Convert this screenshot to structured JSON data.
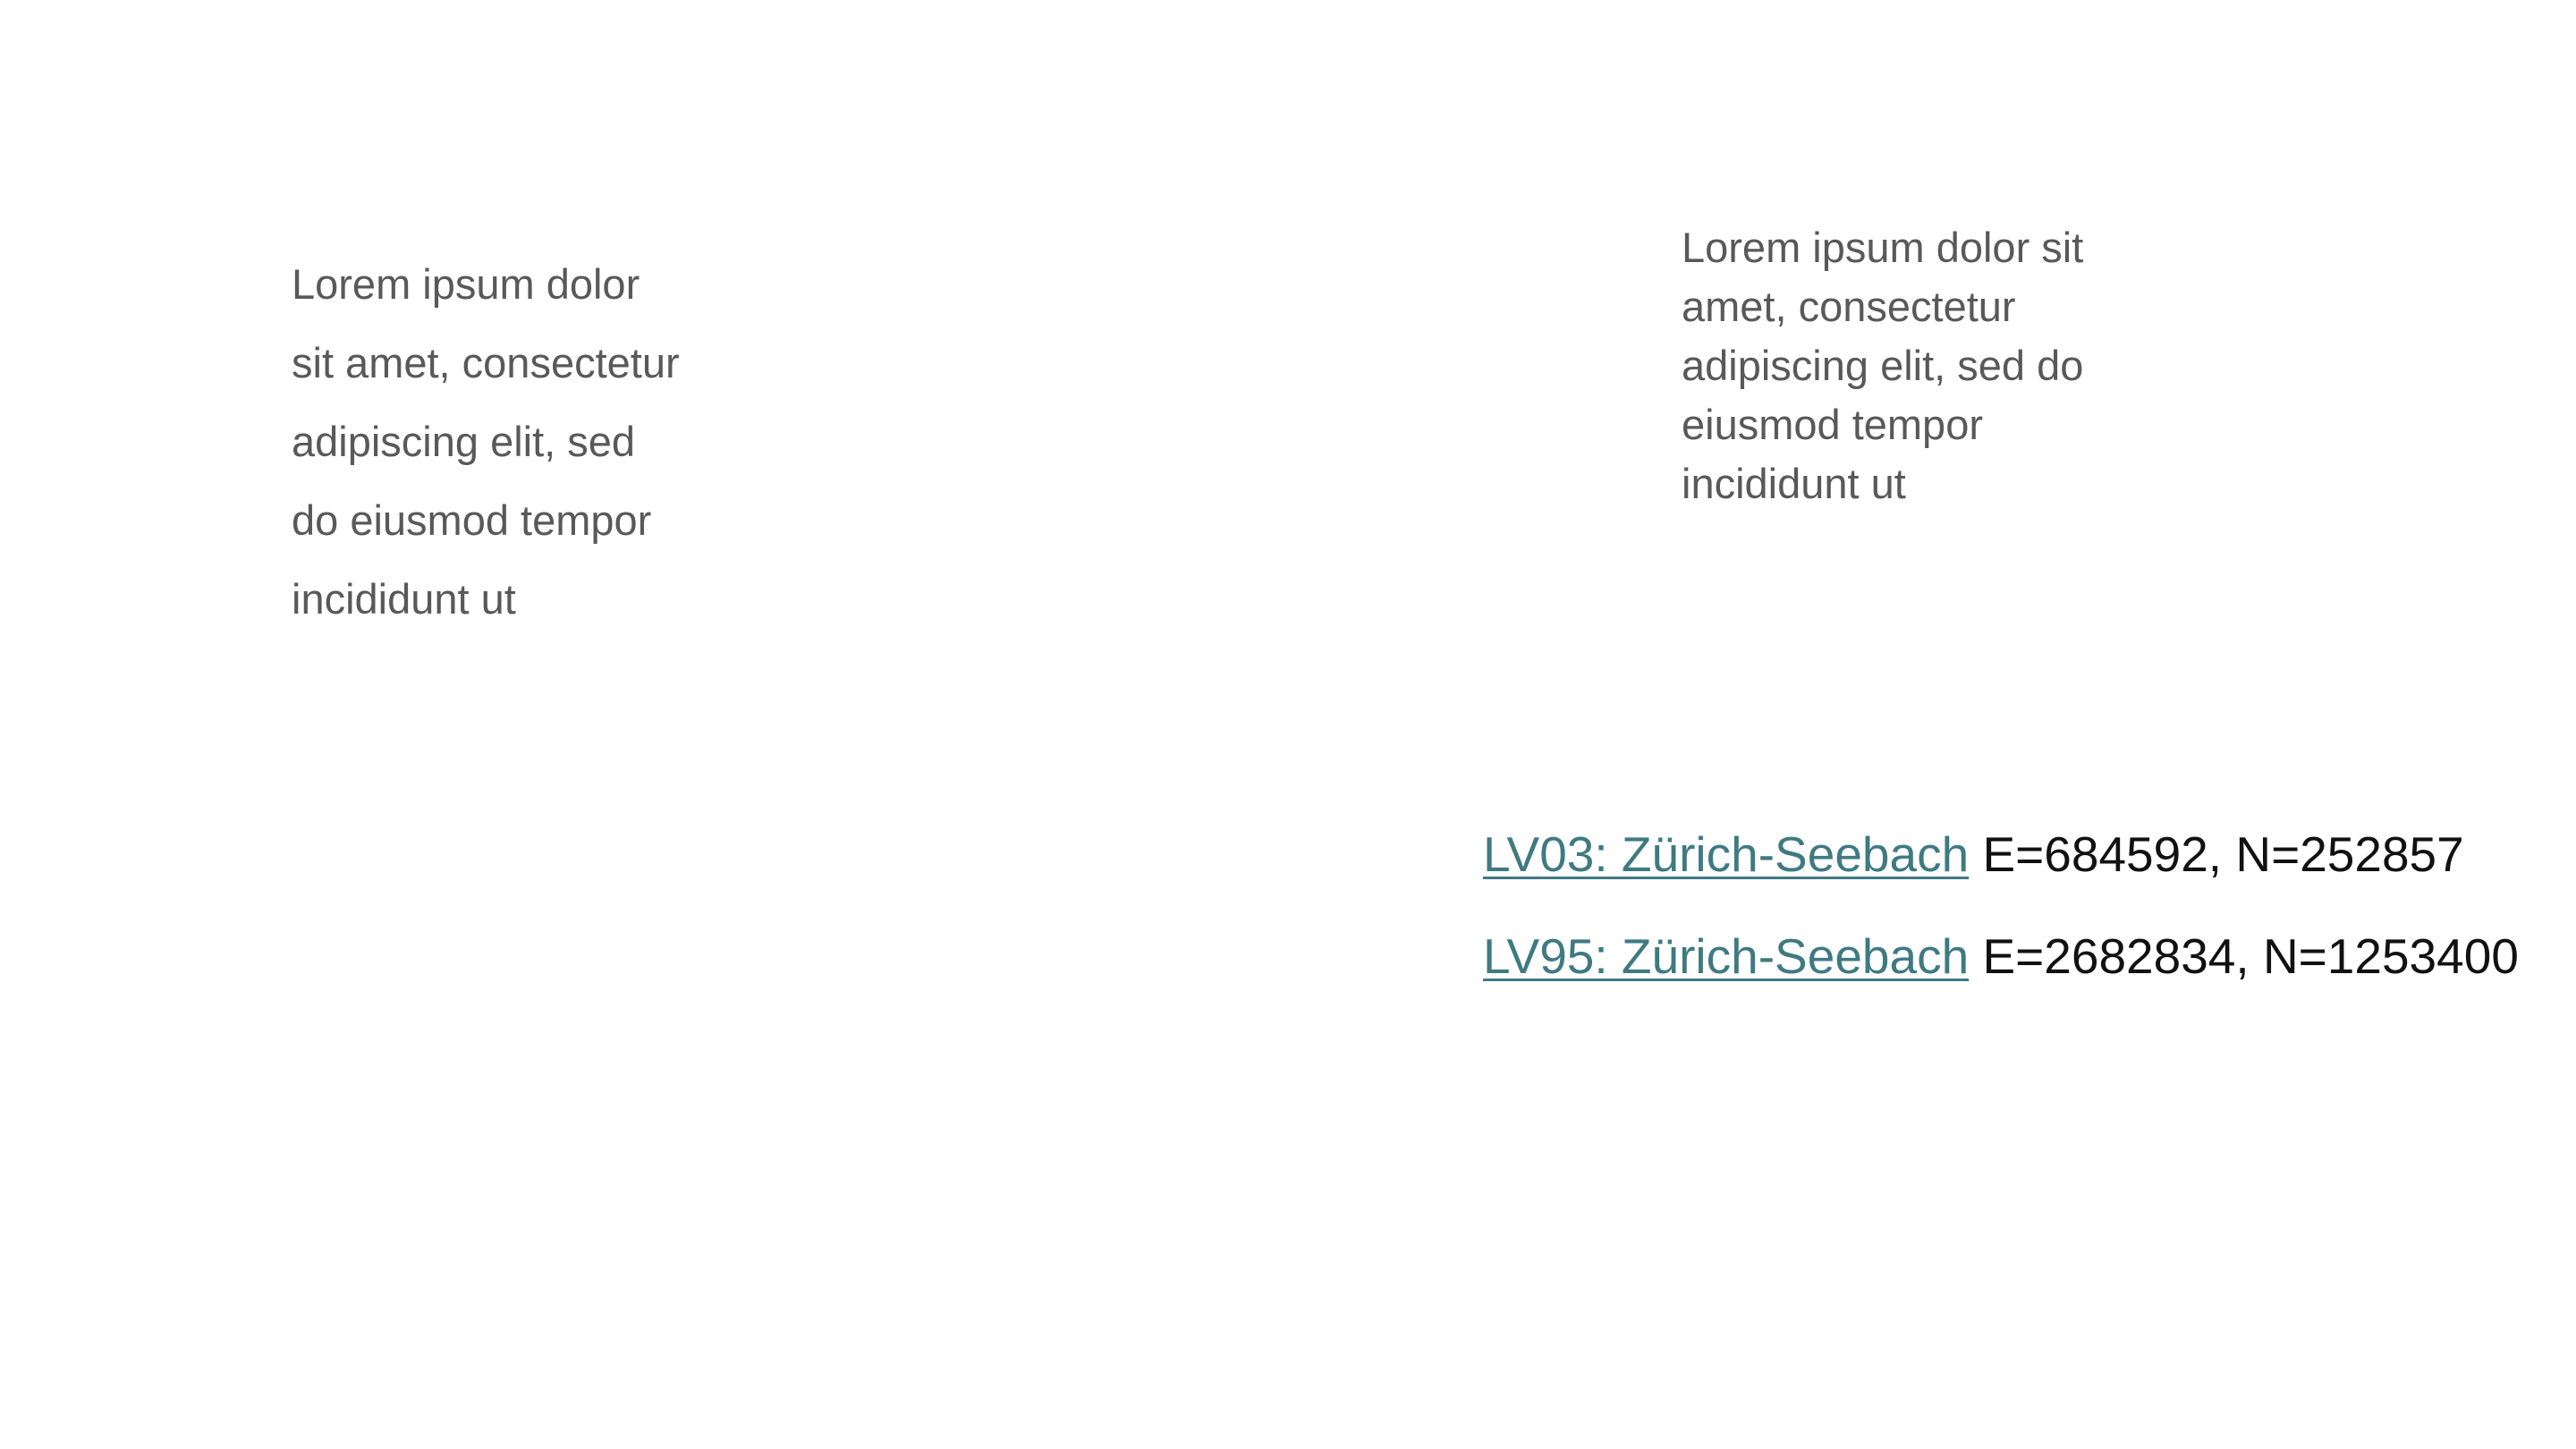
{
  "left_block": {
    "lines": [
      "Lorem ipsum dolor",
      "sit amet, consectetur",
      "adipiscing elit, sed",
      "do eiusmod tempor",
      "incididunt ut"
    ]
  },
  "right_block": {
    "lines": [
      "Lorem ipsum dolor sit",
      "amet, consectetur",
      "adipiscing elit, sed do",
      "eiusmod tempor",
      "incididunt ut"
    ]
  },
  "coordinates": [
    {
      "link_text": "LV03: Zürich-Seebach",
      "value_text": "E=684592, N=252857"
    },
    {
      "link_text": "LV95: Zürich-Seebach",
      "value_text": "E=2682834, N=1253400"
    }
  ],
  "colors": {
    "body_text": "#595959",
    "link": "#3f7a82",
    "coordinate_text": "#111111"
  }
}
